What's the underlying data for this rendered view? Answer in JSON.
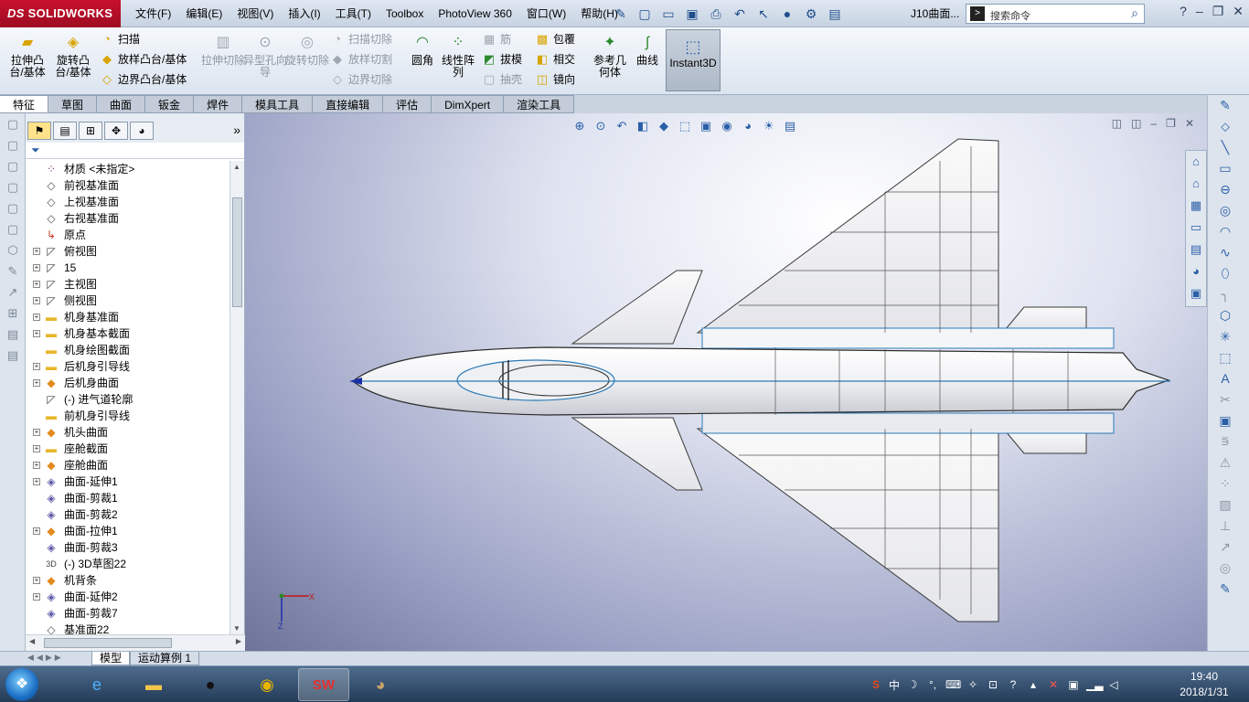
{
  "app": {
    "logo_ds": "DS",
    "logo_text": "SOLIDWORKS",
    "doc_title": "J10曲面..."
  },
  "menu": [
    "文件(F)",
    "编辑(E)",
    "视图(V)",
    "插入(I)",
    "工具(T)",
    "Toolbox",
    "PhotoView 360",
    "窗口(W)",
    "帮助(H)"
  ],
  "search": {
    "placeholder": "搜索命令"
  },
  "cmd": {
    "extrude_boss": "拉伸凸台/基体",
    "revolve_boss": "旋转凸台/基体",
    "sweep": "扫描",
    "loft": "放样凸台/基体",
    "boundary_boss": "边界凸台/基体",
    "extrude_cut": "拉伸切除",
    "hole_wizard": "异型孔向导",
    "revolve_cut": "旋转切除",
    "swept_cut": "扫描切除",
    "lofted_cut": "放样切割",
    "boundary_cut": "边界切除",
    "fillet": "圆角",
    "linear_pattern": "线性阵列",
    "rib": "筋",
    "draft": "拔模",
    "shell": "抽壳",
    "wrap": "包覆",
    "intersect": "相交",
    "mirror": "镜向",
    "ref_geom": "参考几何体",
    "curves": "曲线",
    "instant3d": "Instant3D"
  },
  "tabs": [
    "特征",
    "草图",
    "曲面",
    "钣金",
    "焊件",
    "模具工具",
    "直接编辑",
    "评估",
    "DimXpert",
    "渲染工具"
  ],
  "tree": [
    {
      "icon": "material",
      "exp": "",
      "label": "材质 <未指定>"
    },
    {
      "icon": "plane",
      "exp": "",
      "label": "前视基准面"
    },
    {
      "icon": "plane",
      "exp": "",
      "label": "上视基准面"
    },
    {
      "icon": "plane",
      "exp": "",
      "label": "右视基准面"
    },
    {
      "icon": "origin",
      "exp": "",
      "label": "原点"
    },
    {
      "icon": "sketch",
      "exp": "+",
      "label": "俯视图"
    },
    {
      "icon": "sketch",
      "exp": "+",
      "label": "15"
    },
    {
      "icon": "sketch",
      "exp": "+",
      "label": "主视图"
    },
    {
      "icon": "sketch",
      "exp": "+",
      "label": "侧视图"
    },
    {
      "icon": "folder",
      "exp": "+",
      "label": "机身基准面"
    },
    {
      "icon": "folder",
      "exp": "+",
      "label": "机身基本截面"
    },
    {
      "icon": "folder",
      "exp": "",
      "label": "机身绘图截面"
    },
    {
      "icon": "folder",
      "exp": "+",
      "label": "后机身引导线"
    },
    {
      "icon": "surface",
      "exp": "+",
      "label": "后机身曲面"
    },
    {
      "icon": "sketch",
      "exp": "",
      "label": "(-) 进气道轮廓"
    },
    {
      "icon": "folder",
      "exp": "",
      "label": "前机身引导线"
    },
    {
      "icon": "surface",
      "exp": "+",
      "label": "机头曲面"
    },
    {
      "icon": "folder",
      "exp": "+",
      "label": "座舱截面"
    },
    {
      "icon": "surface",
      "exp": "+",
      "label": "座舱曲面"
    },
    {
      "icon": "cut",
      "exp": "+",
      "label": "曲面-延伸1"
    },
    {
      "icon": "cut",
      "exp": "",
      "label": "曲面-剪裁1"
    },
    {
      "icon": "cut",
      "exp": "",
      "label": "曲面-剪裁2"
    },
    {
      "icon": "surface",
      "exp": "+",
      "label": "曲面-拉伸1"
    },
    {
      "icon": "cut",
      "exp": "",
      "label": "曲面-剪裁3"
    },
    {
      "icon": "sketch3d",
      "exp": "",
      "label": "(-) 3D草图22"
    },
    {
      "icon": "surface",
      "exp": "+",
      "label": "机背条"
    },
    {
      "icon": "cut",
      "exp": "+",
      "label": "曲面-延伸2"
    },
    {
      "icon": "cut",
      "exp": "",
      "label": "曲面-剪裁7"
    },
    {
      "icon": "plane",
      "exp": "",
      "label": "基准面22"
    }
  ],
  "triad": {
    "x": "X",
    "z": "Z"
  },
  "bottom_tabs": [
    "模型",
    "运动算例 1"
  ],
  "tray": {
    "ime": "中"
  },
  "clock": {
    "time": "19:40",
    "date": "2018/1/31"
  }
}
